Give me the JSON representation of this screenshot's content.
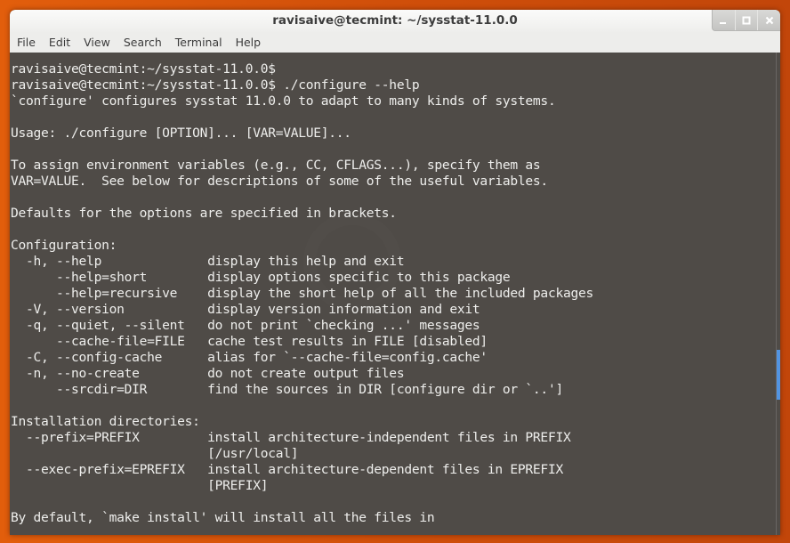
{
  "window": {
    "title": "ravisaive@tecmint: ~/sysstat-11.0.0"
  },
  "window_controls": {
    "minimize": "minimize",
    "maximize": "maximize",
    "close": "close"
  },
  "menubar": {
    "items": [
      "File",
      "Edit",
      "View",
      "Search",
      "Terminal",
      "Help"
    ]
  },
  "terminal": {
    "lines": [
      "ravisaive@tecmint:~/sysstat-11.0.0$",
      "ravisaive@tecmint:~/sysstat-11.0.0$ ./configure --help",
      "`configure' configures sysstat 11.0.0 to adapt to many kinds of systems.",
      "",
      "Usage: ./configure [OPTION]... [VAR=VALUE]...",
      "",
      "To assign environment variables (e.g., CC, CFLAGS...), specify them as",
      "VAR=VALUE.  See below for descriptions of some of the useful variables.",
      "",
      "Defaults for the options are specified in brackets.",
      "",
      "Configuration:",
      "  -h, --help              display this help and exit",
      "      --help=short        display options specific to this package",
      "      --help=recursive    display the short help of all the included packages",
      "  -V, --version           display version information and exit",
      "  -q, --quiet, --silent   do not print `checking ...' messages",
      "      --cache-file=FILE   cache test results in FILE [disabled]",
      "  -C, --config-cache      alias for `--cache-file=config.cache'",
      "  -n, --no-create         do not create output files",
      "      --srcdir=DIR        find the sources in DIR [configure dir or `..']",
      "",
      "Installation directories:",
      "  --prefix=PREFIX         install architecture-independent files in PREFIX",
      "                          [/usr/local]",
      "  --exec-prefix=EPREFIX   install architecture-dependent files in EPREFIX",
      "                          [PREFIX]",
      "",
      "By default, `make install' will install all the files in"
    ]
  },
  "colors": {
    "desktop": "#d9560b",
    "terminal_bg": "#4f4b47",
    "terminal_fg": "#eeeeec",
    "scroll_thumb": "#5294e2"
  }
}
